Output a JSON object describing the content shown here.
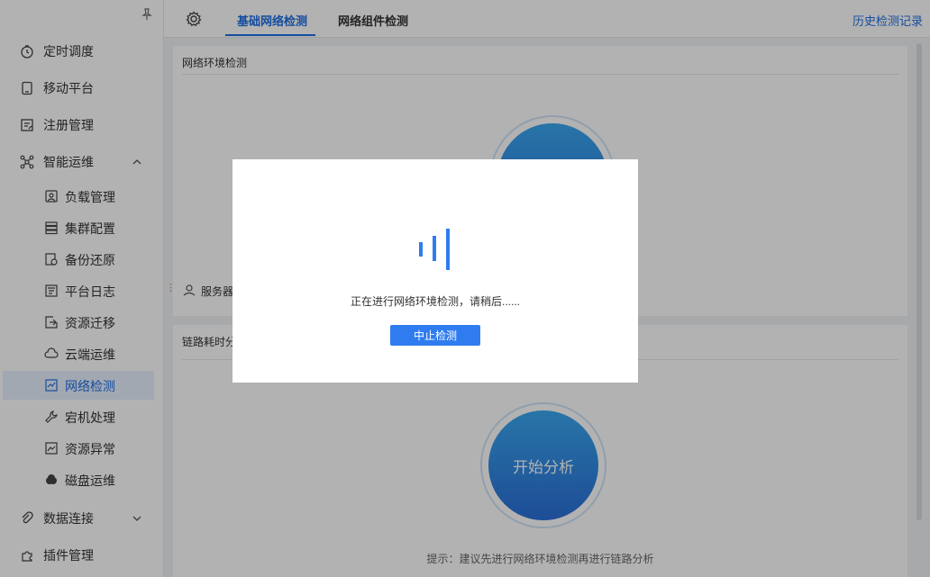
{
  "sidebar": {
    "items": [
      {
        "label": "定时调度",
        "icon": "clock-icon"
      },
      {
        "label": "移动平台",
        "icon": "mobile-icon"
      },
      {
        "label": "注册管理",
        "icon": "register-icon"
      },
      {
        "label": "智能运维",
        "icon": "ops-icon",
        "expanded": true
      },
      {
        "label": "数据连接",
        "icon": "link-icon",
        "expanded": false
      },
      {
        "label": "插件管理",
        "icon": "plugin-icon"
      }
    ],
    "sub_items": [
      {
        "label": "负载管理",
        "icon": "load-icon"
      },
      {
        "label": "集群配置",
        "icon": "cluster-icon"
      },
      {
        "label": "备份还原",
        "icon": "backup-icon"
      },
      {
        "label": "平台日志",
        "icon": "log-icon"
      },
      {
        "label": "资源迁移",
        "icon": "migrate-icon"
      },
      {
        "label": "云端运维",
        "icon": "cloud-icon"
      },
      {
        "label": "网络检测",
        "icon": "network-icon",
        "active": true
      },
      {
        "label": "宕机处理",
        "icon": "wrench-icon"
      },
      {
        "label": "资源异常",
        "icon": "anomaly-icon"
      },
      {
        "label": "磁盘运维",
        "icon": "disk-icon"
      }
    ]
  },
  "tabs": [
    {
      "label": "基础网络检测",
      "active": true
    },
    {
      "label": "网络组件检测",
      "active": false
    }
  ],
  "history_link": "历史检测记录",
  "panel_network": {
    "title": "网络环境检测",
    "server_label": "服务器"
  },
  "panel_chain": {
    "title": "链路耗时分",
    "button": "开始分析",
    "hint": "提示：建议先进行网络环境检测再进行链路分析"
  },
  "modal": {
    "message": "正在进行网络环境检测，请稍后......",
    "stop_button": "中止检测"
  },
  "colors": {
    "accent": "#1f6fe5",
    "active_bg": "#e8f1fe"
  }
}
